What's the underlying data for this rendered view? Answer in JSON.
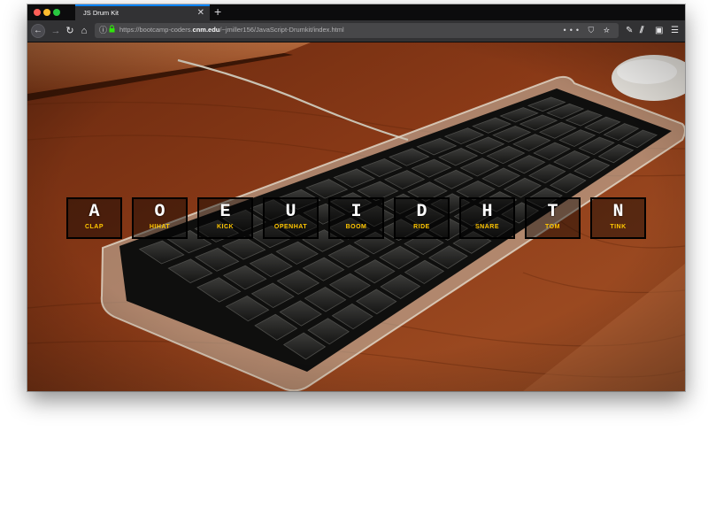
{
  "browser": {
    "tab_title": "JS Drum Kit",
    "url_prefix": "https://bootcamp-coders.",
    "url_domain": "cnm.edu",
    "url_path": "/~jmiller156/JavaScript-Drumkit/index.html",
    "icons": [
      "back-arrow-icon",
      "forward-arrow-icon",
      "reload-icon",
      "home-icon",
      "info-icon",
      "lock-icon",
      "more-icon",
      "pocket-icon",
      "star-icon",
      "wrench-icon",
      "library-icon",
      "sidebar-icon",
      "hamburger-menu-icon"
    ]
  },
  "colors": {
    "key_sound_label": "#ffc600",
    "key_letter": "#ffffff",
    "key_border": "#000000",
    "wood": "#8a3a18"
  },
  "drumkit": {
    "keys": [
      {
        "letter": "A",
        "sound": "CLAP"
      },
      {
        "letter": "O",
        "sound": "HIHAT"
      },
      {
        "letter": "E",
        "sound": "KICK"
      },
      {
        "letter": "U",
        "sound": "OPENHAT"
      },
      {
        "letter": "I",
        "sound": "BOOM"
      },
      {
        "letter": "D",
        "sound": "RIDE"
      },
      {
        "letter": "H",
        "sound": "SNARE"
      },
      {
        "letter": "T",
        "sound": "TOM"
      },
      {
        "letter": "N",
        "sound": "TINK"
      }
    ]
  }
}
